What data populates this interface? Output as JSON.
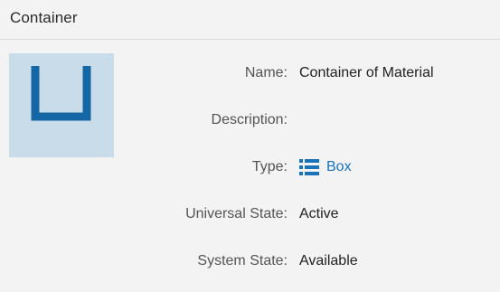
{
  "header": {
    "title": "Container"
  },
  "thumbnail": {
    "icon": "container-icon",
    "background": "#c9dcea",
    "stroke": "#1467a4"
  },
  "fields": {
    "name": {
      "label": "Name:",
      "value": "Container of Material"
    },
    "description": {
      "label": "Description:",
      "value": ""
    },
    "type": {
      "label": "Type:",
      "value": "Box",
      "icon": "list-icon",
      "color": "#1a72b8"
    },
    "universal_state": {
      "label": "Universal State:",
      "value": "Active"
    },
    "system_state": {
      "label": "System State:",
      "value": "Available"
    }
  }
}
